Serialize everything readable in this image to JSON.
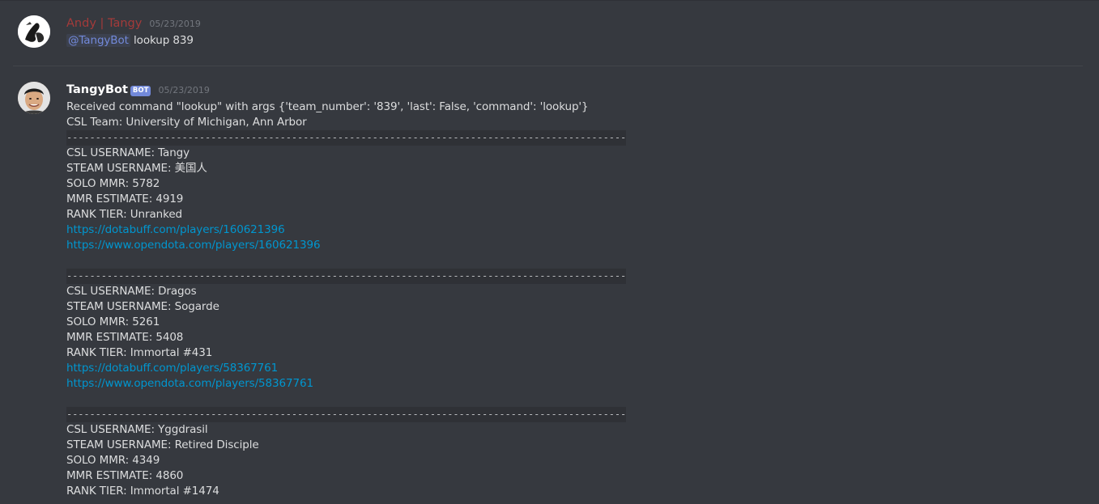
{
  "message1": {
    "username": "Andy | Tangy",
    "timestamp": "05/23/2019",
    "mention": "@TangyBot",
    "text": " lookup 839"
  },
  "message2": {
    "username": "TangyBot",
    "bot_tag": "BOT",
    "timestamp": "05/23/2019",
    "command_line": "Received command \"lookup\" with args {'team_number': '839', 'last': False, 'command': 'lookup'}",
    "team_line": "CSL Team: University of Michigan, Ann Arbor",
    "separator": "----------------------------------------------------------------------------------------------------------------------------------",
    "players": [
      {
        "csl": "CSL USERNAME:   Tangy",
        "steam": "STEAM USERNAME: 美国人",
        "solo": "SOLO MMR: 5782",
        "estimate": "MMR ESTIMATE: 4919",
        "rank": "RANK TIER: Unranked",
        "dotabuff": "https://dotabuff.com/players/160621396",
        "opendota": "https://www.opendota.com/players/160621396"
      },
      {
        "csl": "CSL USERNAME:   Dragos",
        "steam": "STEAM USERNAME: Sogarde",
        "solo": "SOLO MMR: 5261",
        "estimate": "MMR ESTIMATE: 5408",
        "rank": "RANK TIER: Immortal #431",
        "dotabuff": "https://dotabuff.com/players/58367761",
        "opendota": "https://www.opendota.com/players/58367761"
      },
      {
        "csl": "CSL USERNAME:   Yggdrasil",
        "steam": "STEAM USERNAME: Retired Disciple",
        "solo": "SOLO MMR: 4349",
        "estimate": "MMR ESTIMATE: 4860",
        "rank": "RANK TIER: Immortal #1474"
      }
    ]
  },
  "colors": {
    "background": "#36393f",
    "text": "#dcddde",
    "user_red": "#a33a3a",
    "link": "#0096cf",
    "mention": "#7289da",
    "timestamp": "#72767d"
  }
}
